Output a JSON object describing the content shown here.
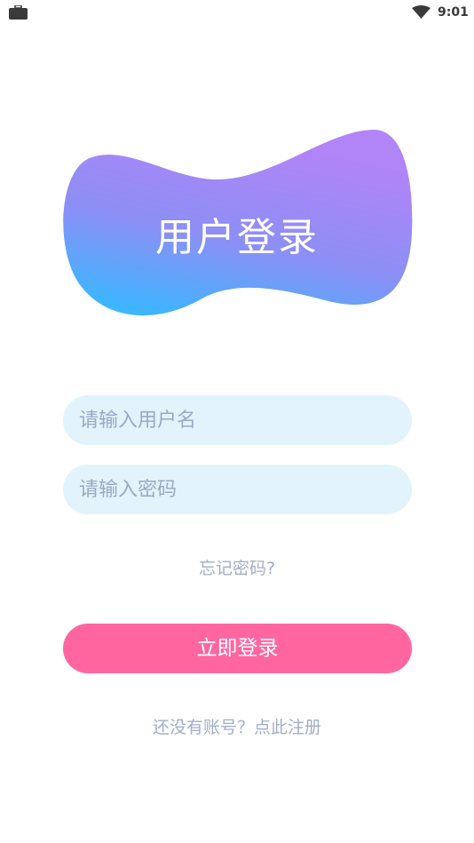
{
  "status_bar": {
    "time": "9:01",
    "left_icon": "briefcase-icon",
    "right_icon": "wifi-icon"
  },
  "header": {
    "title": "用户登录",
    "gradient_start": "#3fb4ff",
    "gradient_end": "#b184f7"
  },
  "form": {
    "username_placeholder": "请输入用户名",
    "username_value": "",
    "password_placeholder": "请输入密码",
    "password_value": "",
    "field_color": "#e2f3fb"
  },
  "links": {
    "forgot_password": "忘记密码?",
    "register": "还没有账号？点此注册"
  },
  "actions": {
    "login_label": "立即登录",
    "login_color": "#ff66a0"
  }
}
